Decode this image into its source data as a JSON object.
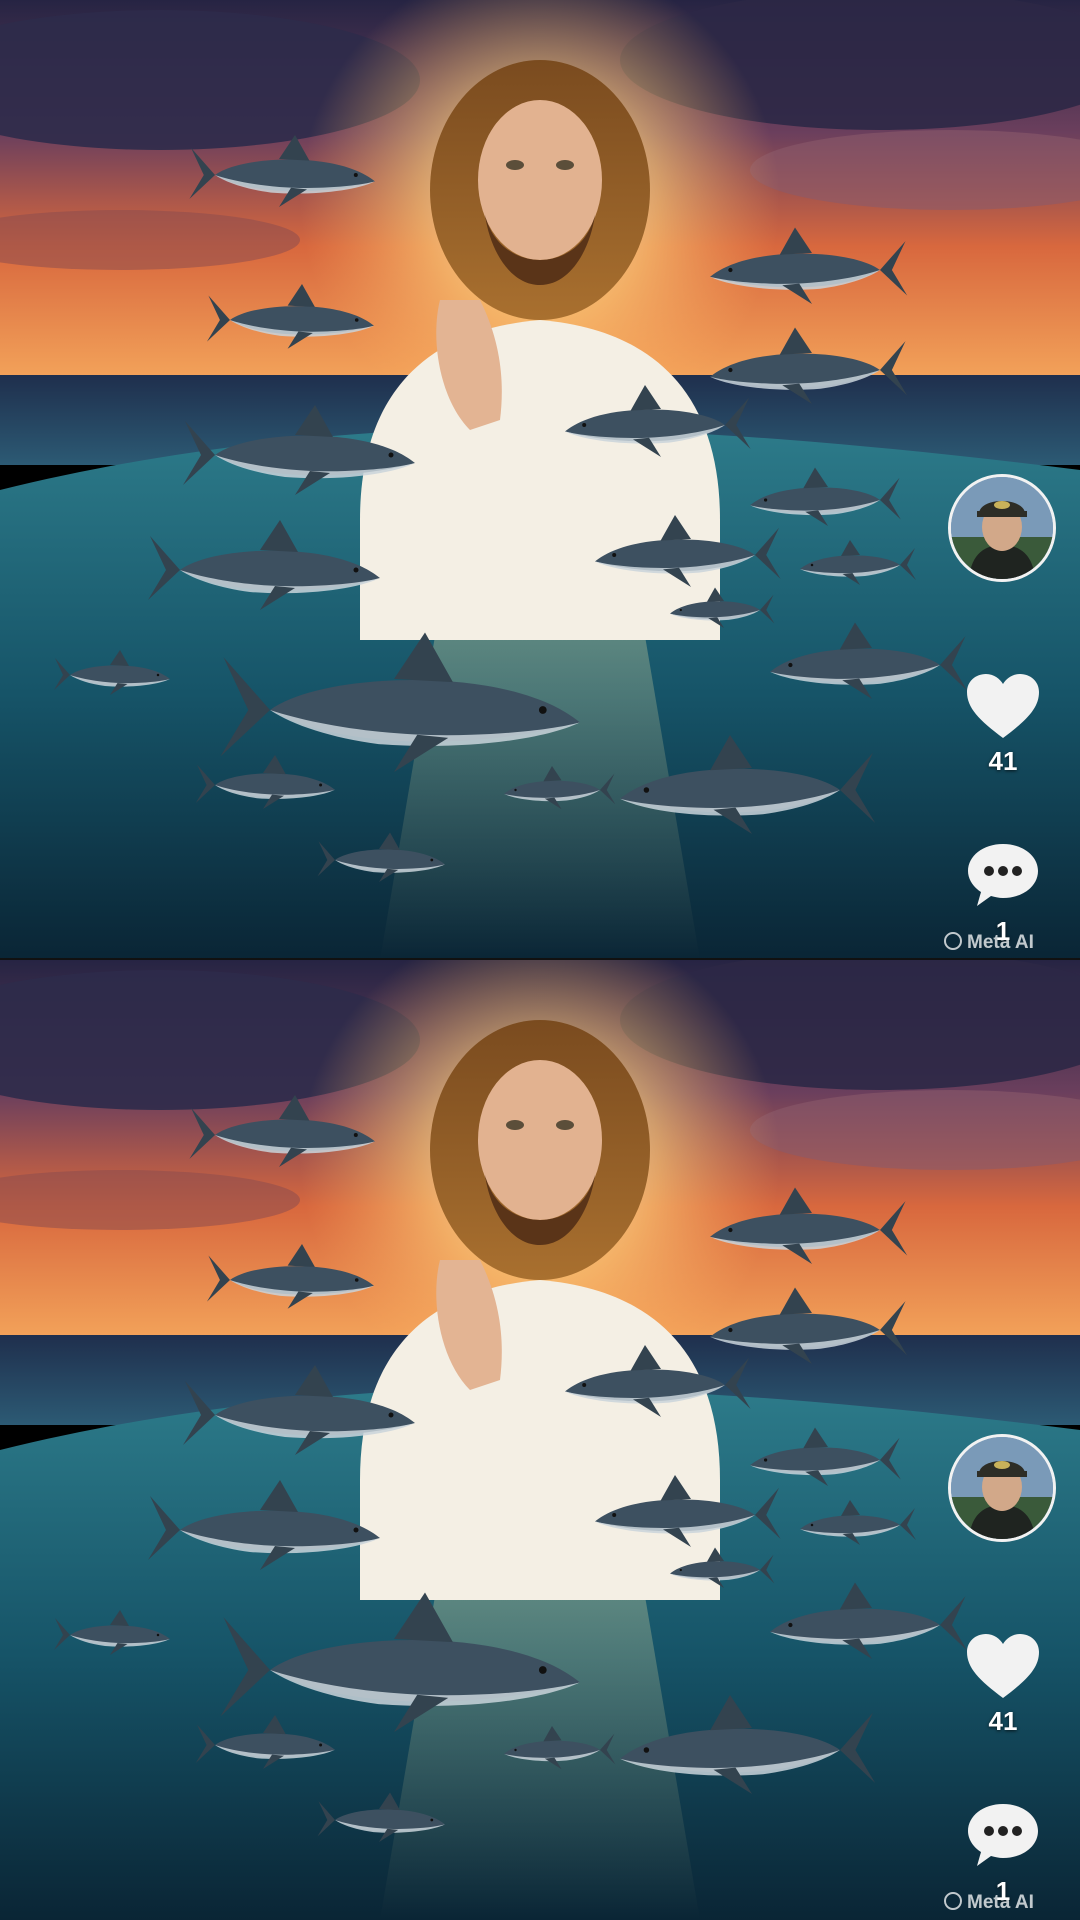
{
  "post": {
    "creator_avatar_icon": "user-avatar",
    "like_icon": "heart-icon",
    "like_count": "41",
    "comment_icon": "comment-bubble-icon",
    "comment_count": "1",
    "watermark": "Meta AI"
  },
  "colors": {
    "sky_top": "#2a2748",
    "sunset_orange": "#f08a3a",
    "sea": "#1c5a6b",
    "deep_sea": "#0b2a3a",
    "shark": "#3d5060"
  }
}
